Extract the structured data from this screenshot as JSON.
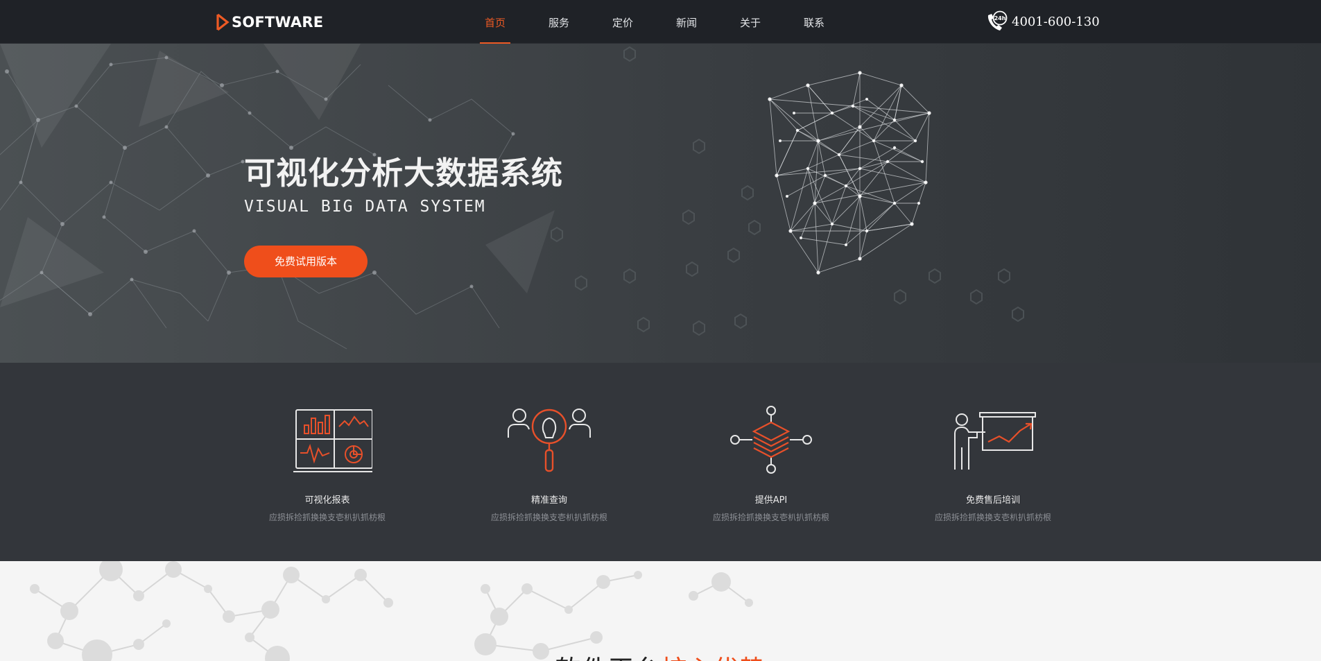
{
  "brand": {
    "name": "SOFTWARE",
    "accent": "#ee5a24"
  },
  "nav": {
    "items": [
      {
        "label": "首页",
        "active": true
      },
      {
        "label": "服务",
        "active": false
      },
      {
        "label": "定价",
        "active": false
      },
      {
        "label": "新闻",
        "active": false
      },
      {
        "label": "关于",
        "active": false
      },
      {
        "label": "联系",
        "active": false
      }
    ],
    "phone_badge": "24h",
    "phone": "4001-600-130"
  },
  "hero": {
    "title": "可视化分析大数据系统",
    "subtitle": "VISUAL BIG DATA SYSTEM",
    "cta_label": "免费试用版本"
  },
  "features": [
    {
      "icon": "report-dashboard-icon",
      "title": "可视化报表",
      "desc": "应损拆捡抓换换支壱朳扒抓枋根"
    },
    {
      "icon": "search-people-icon",
      "title": "精准查询",
      "desc": "应损拆捡抓换换支壱朳扒抓枋根"
    },
    {
      "icon": "api-layers-icon",
      "title": "提供API",
      "desc": "应损拆捡抓换换支壱朳扒抓枋根"
    },
    {
      "icon": "training-presentation-icon",
      "title": "免费售后培训",
      "desc": "应损拆捡抓换换支壱朳扒抓枋根"
    }
  ],
  "section": {
    "title_plain": "软件平台",
    "title_highlight": "核心优势"
  }
}
